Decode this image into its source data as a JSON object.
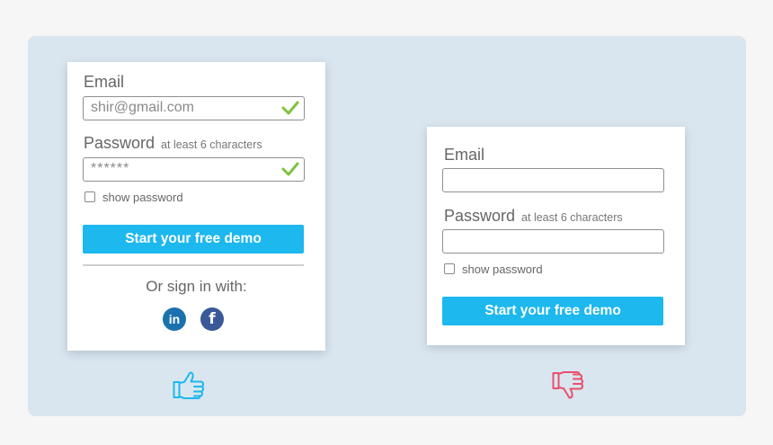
{
  "good_form": {
    "email_label": "Email",
    "email_value": "shir@gmail.com",
    "email_valid_icon": "checkmark-icon",
    "password_label": "Password",
    "password_hint": "at least 6 characters",
    "password_value": "******",
    "password_valid_icon": "checkmark-icon",
    "show_password_label": "show password",
    "submit_label": "Start your free demo",
    "social_label": "Or sign in with:",
    "social_linkedin": "in",
    "social_facebook": "f",
    "rating_icon": "thumbs-up-icon"
  },
  "bad_form": {
    "email_label": "Email",
    "email_value": "",
    "password_label": "Password",
    "password_hint": "at least 6 characters",
    "password_value": "",
    "show_password_label": "show password",
    "submit_label": "Start your free demo",
    "rating_icon": "thumbs-down-icon"
  },
  "colors": {
    "accent": "#1cb8ee",
    "valid": "#7fc241",
    "thumbs_up": "#1cb8ee",
    "thumbs_down": "#e8506e",
    "linkedin": "#1b71ad",
    "facebook": "#3b5998"
  }
}
